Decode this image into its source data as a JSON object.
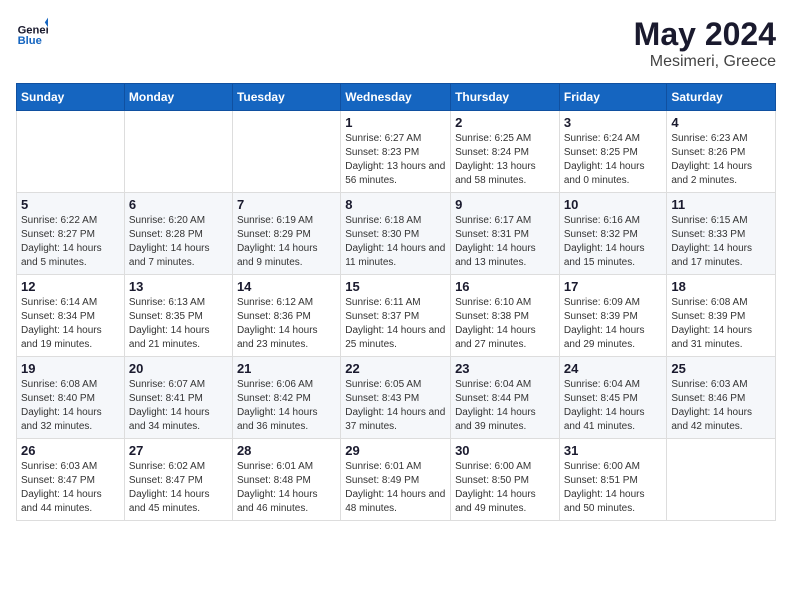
{
  "header": {
    "logo_line1": "General",
    "logo_line2": "Blue",
    "month": "May 2024",
    "location": "Mesimeri, Greece"
  },
  "weekdays": [
    "Sunday",
    "Monday",
    "Tuesday",
    "Wednesday",
    "Thursday",
    "Friday",
    "Saturday"
  ],
  "weeks": [
    [
      {
        "day": "",
        "info": ""
      },
      {
        "day": "",
        "info": ""
      },
      {
        "day": "",
        "info": ""
      },
      {
        "day": "1",
        "info": "Sunrise: 6:27 AM\nSunset: 8:23 PM\nDaylight: 13 hours and 56 minutes."
      },
      {
        "day": "2",
        "info": "Sunrise: 6:25 AM\nSunset: 8:24 PM\nDaylight: 13 hours and 58 minutes."
      },
      {
        "day": "3",
        "info": "Sunrise: 6:24 AM\nSunset: 8:25 PM\nDaylight: 14 hours and 0 minutes."
      },
      {
        "day": "4",
        "info": "Sunrise: 6:23 AM\nSunset: 8:26 PM\nDaylight: 14 hours and 2 minutes."
      }
    ],
    [
      {
        "day": "5",
        "info": "Sunrise: 6:22 AM\nSunset: 8:27 PM\nDaylight: 14 hours and 5 minutes."
      },
      {
        "day": "6",
        "info": "Sunrise: 6:20 AM\nSunset: 8:28 PM\nDaylight: 14 hours and 7 minutes."
      },
      {
        "day": "7",
        "info": "Sunrise: 6:19 AM\nSunset: 8:29 PM\nDaylight: 14 hours and 9 minutes."
      },
      {
        "day": "8",
        "info": "Sunrise: 6:18 AM\nSunset: 8:30 PM\nDaylight: 14 hours and 11 minutes."
      },
      {
        "day": "9",
        "info": "Sunrise: 6:17 AM\nSunset: 8:31 PM\nDaylight: 14 hours and 13 minutes."
      },
      {
        "day": "10",
        "info": "Sunrise: 6:16 AM\nSunset: 8:32 PM\nDaylight: 14 hours and 15 minutes."
      },
      {
        "day": "11",
        "info": "Sunrise: 6:15 AM\nSunset: 8:33 PM\nDaylight: 14 hours and 17 minutes."
      }
    ],
    [
      {
        "day": "12",
        "info": "Sunrise: 6:14 AM\nSunset: 8:34 PM\nDaylight: 14 hours and 19 minutes."
      },
      {
        "day": "13",
        "info": "Sunrise: 6:13 AM\nSunset: 8:35 PM\nDaylight: 14 hours and 21 minutes."
      },
      {
        "day": "14",
        "info": "Sunrise: 6:12 AM\nSunset: 8:36 PM\nDaylight: 14 hours and 23 minutes."
      },
      {
        "day": "15",
        "info": "Sunrise: 6:11 AM\nSunset: 8:37 PM\nDaylight: 14 hours and 25 minutes."
      },
      {
        "day": "16",
        "info": "Sunrise: 6:10 AM\nSunset: 8:38 PM\nDaylight: 14 hours and 27 minutes."
      },
      {
        "day": "17",
        "info": "Sunrise: 6:09 AM\nSunset: 8:39 PM\nDaylight: 14 hours and 29 minutes."
      },
      {
        "day": "18",
        "info": "Sunrise: 6:08 AM\nSunset: 8:39 PM\nDaylight: 14 hours and 31 minutes."
      }
    ],
    [
      {
        "day": "19",
        "info": "Sunrise: 6:08 AM\nSunset: 8:40 PM\nDaylight: 14 hours and 32 minutes."
      },
      {
        "day": "20",
        "info": "Sunrise: 6:07 AM\nSunset: 8:41 PM\nDaylight: 14 hours and 34 minutes."
      },
      {
        "day": "21",
        "info": "Sunrise: 6:06 AM\nSunset: 8:42 PM\nDaylight: 14 hours and 36 minutes."
      },
      {
        "day": "22",
        "info": "Sunrise: 6:05 AM\nSunset: 8:43 PM\nDaylight: 14 hours and 37 minutes."
      },
      {
        "day": "23",
        "info": "Sunrise: 6:04 AM\nSunset: 8:44 PM\nDaylight: 14 hours and 39 minutes."
      },
      {
        "day": "24",
        "info": "Sunrise: 6:04 AM\nSunset: 8:45 PM\nDaylight: 14 hours and 41 minutes."
      },
      {
        "day": "25",
        "info": "Sunrise: 6:03 AM\nSunset: 8:46 PM\nDaylight: 14 hours and 42 minutes."
      }
    ],
    [
      {
        "day": "26",
        "info": "Sunrise: 6:03 AM\nSunset: 8:47 PM\nDaylight: 14 hours and 44 minutes."
      },
      {
        "day": "27",
        "info": "Sunrise: 6:02 AM\nSunset: 8:47 PM\nDaylight: 14 hours and 45 minutes."
      },
      {
        "day": "28",
        "info": "Sunrise: 6:01 AM\nSunset: 8:48 PM\nDaylight: 14 hours and 46 minutes."
      },
      {
        "day": "29",
        "info": "Sunrise: 6:01 AM\nSunset: 8:49 PM\nDaylight: 14 hours and 48 minutes."
      },
      {
        "day": "30",
        "info": "Sunrise: 6:00 AM\nSunset: 8:50 PM\nDaylight: 14 hours and 49 minutes."
      },
      {
        "day": "31",
        "info": "Sunrise: 6:00 AM\nSunset: 8:51 PM\nDaylight: 14 hours and 50 minutes."
      },
      {
        "day": "",
        "info": ""
      }
    ]
  ]
}
